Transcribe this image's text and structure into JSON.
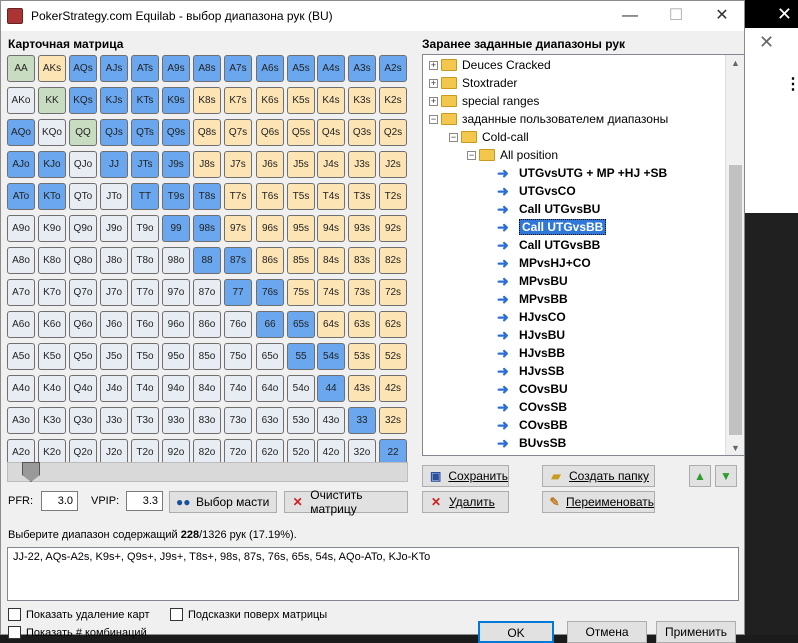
{
  "window": {
    "title": "PokerStrategy.com Equilab - выбор диапазона рук (BU)"
  },
  "matrix": {
    "title": "Карточная матрица",
    "cells": [
      [
        "AA",
        "AKs",
        "AQs",
        "AJs",
        "ATs",
        "A9s",
        "A8s",
        "A7s",
        "A6s",
        "A5s",
        "A4s",
        "A3s",
        "A2s"
      ],
      [
        "AKo",
        "KK",
        "KQs",
        "KJs",
        "KTs",
        "K9s",
        "K8s",
        "K7s",
        "K6s",
        "K5s",
        "K4s",
        "K3s",
        "K2s"
      ],
      [
        "AQo",
        "KQo",
        "QQ",
        "QJs",
        "QTs",
        "Q9s",
        "Q8s",
        "Q7s",
        "Q6s",
        "Q5s",
        "Q4s",
        "Q3s",
        "Q2s"
      ],
      [
        "AJo",
        "KJo",
        "QJo",
        "JJ",
        "JTs",
        "J9s",
        "J8s",
        "J7s",
        "J6s",
        "J5s",
        "J4s",
        "J3s",
        "J2s"
      ],
      [
        "ATo",
        "KTo",
        "QTo",
        "JTo",
        "TT",
        "T9s",
        "T8s",
        "T7s",
        "T6s",
        "T5s",
        "T4s",
        "T3s",
        "T2s"
      ],
      [
        "A9o",
        "K9o",
        "Q9o",
        "J9o",
        "T9o",
        "99",
        "98s",
        "97s",
        "96s",
        "95s",
        "94s",
        "93s",
        "92s"
      ],
      [
        "A8o",
        "K8o",
        "Q8o",
        "J8o",
        "T8o",
        "98o",
        "88",
        "87s",
        "86s",
        "85s",
        "84s",
        "83s",
        "82s"
      ],
      [
        "A7o",
        "K7o",
        "Q7o",
        "J7o",
        "T7o",
        "97o",
        "87o",
        "77",
        "76s",
        "75s",
        "74s",
        "73s",
        "72s"
      ],
      [
        "A6o",
        "K6o",
        "Q6o",
        "J6o",
        "T6o",
        "96o",
        "86o",
        "76o",
        "66",
        "65s",
        "64s",
        "63s",
        "62s"
      ],
      [
        "A5o",
        "K5o",
        "Q5o",
        "J5o",
        "T5o",
        "95o",
        "85o",
        "75o",
        "65o",
        "55",
        "54s",
        "53s",
        "52s"
      ],
      [
        "A4o",
        "K4o",
        "Q4o",
        "J4o",
        "T4o",
        "94o",
        "84o",
        "74o",
        "64o",
        "54o",
        "44",
        "43s",
        "42s"
      ],
      [
        "A3o",
        "K3o",
        "Q3o",
        "J3o",
        "T3o",
        "93o",
        "83o",
        "73o",
        "63o",
        "53o",
        "43o",
        "33",
        "32s"
      ],
      [
        "A2o",
        "K2o",
        "Q2o",
        "J2o",
        "T2o",
        "92o",
        "82o",
        "72o",
        "62o",
        "52o",
        "42o",
        "32o",
        "22"
      ]
    ],
    "selected": [
      "JJ",
      "TT",
      "99",
      "88",
      "77",
      "66",
      "55",
      "44",
      "33",
      "22",
      "AQs",
      "AJs",
      "ATs",
      "A9s",
      "A8s",
      "A7s",
      "A6s",
      "A5s",
      "A4s",
      "A3s",
      "A2s",
      "K9s",
      "KTs",
      "KJs",
      "KQs",
      "Q9s",
      "QTs",
      "QJs",
      "J9s",
      "JTs",
      "T8s",
      "T9s",
      "98s",
      "87s",
      "76s",
      "65s",
      "54s",
      "AQo",
      "AJo",
      "ATo",
      "KJo",
      "KTo"
    ],
    "colors": {
      "pair": "#c7dcc0",
      "suited": "#fde4b4",
      "offsuit": "#e7edf3",
      "selected": "#6aa7ef"
    }
  },
  "tree": {
    "title": "Заранее заданные диапазоны рук",
    "folders": [
      "Deuces Cracked",
      "Stoxtrader",
      "special ranges",
      "заданные пользователем диапазоны",
      "Cold-call",
      "All position"
    ],
    "leaves": [
      "UTGvsUTG + MP +HJ +SB",
      "UTGvsCO",
      "Call UTGvsBU",
      "Call UTGvsBB",
      "Call UTGvsBB",
      "MPvsHJ+CO",
      "MPvsBU",
      "MPvsBB",
      "HJvsCO",
      "HJvsBU",
      "HJvsBB",
      "HJvsSB",
      "COvsBU",
      "COvsSB",
      "COvsBB",
      "BUvsSB"
    ],
    "selected_index": 3
  },
  "buttons": {
    "save": "Сохранить",
    "create_folder": "Создать папку",
    "delete": "Удалить",
    "rename": "Переименовать",
    "suits": "Выбор масти",
    "clear": "Очистить матрицу",
    "ok": "OK",
    "cancel": "Отмена",
    "apply": "Применить"
  },
  "stats": {
    "pfr_label": "PFR:",
    "pfr": "3.0",
    "vpip_label": "VPIP:",
    "vpip": "3.3",
    "slider_fraction": 0.03
  },
  "status": {
    "prefix": "Выберите диапазон содержащий ",
    "count": "228",
    "suffix": "/1326 рук (17.19%)."
  },
  "range_text": "JJ-22, AQs-A2s, K9s+, Q9s+, J9s+, T8s+, 98s, 87s, 76s, 65s, 54s, AQo-ATo, KJo-KTo",
  "checkboxes": {
    "show_removal": "Показать удаление карт",
    "hints": "Подсказки поверх матрицы",
    "show_combos": "Показать # комбинаций"
  },
  "icons": {
    "minimize": "minimize-icon",
    "maximize": "maximize-icon",
    "close": "close-icon"
  }
}
